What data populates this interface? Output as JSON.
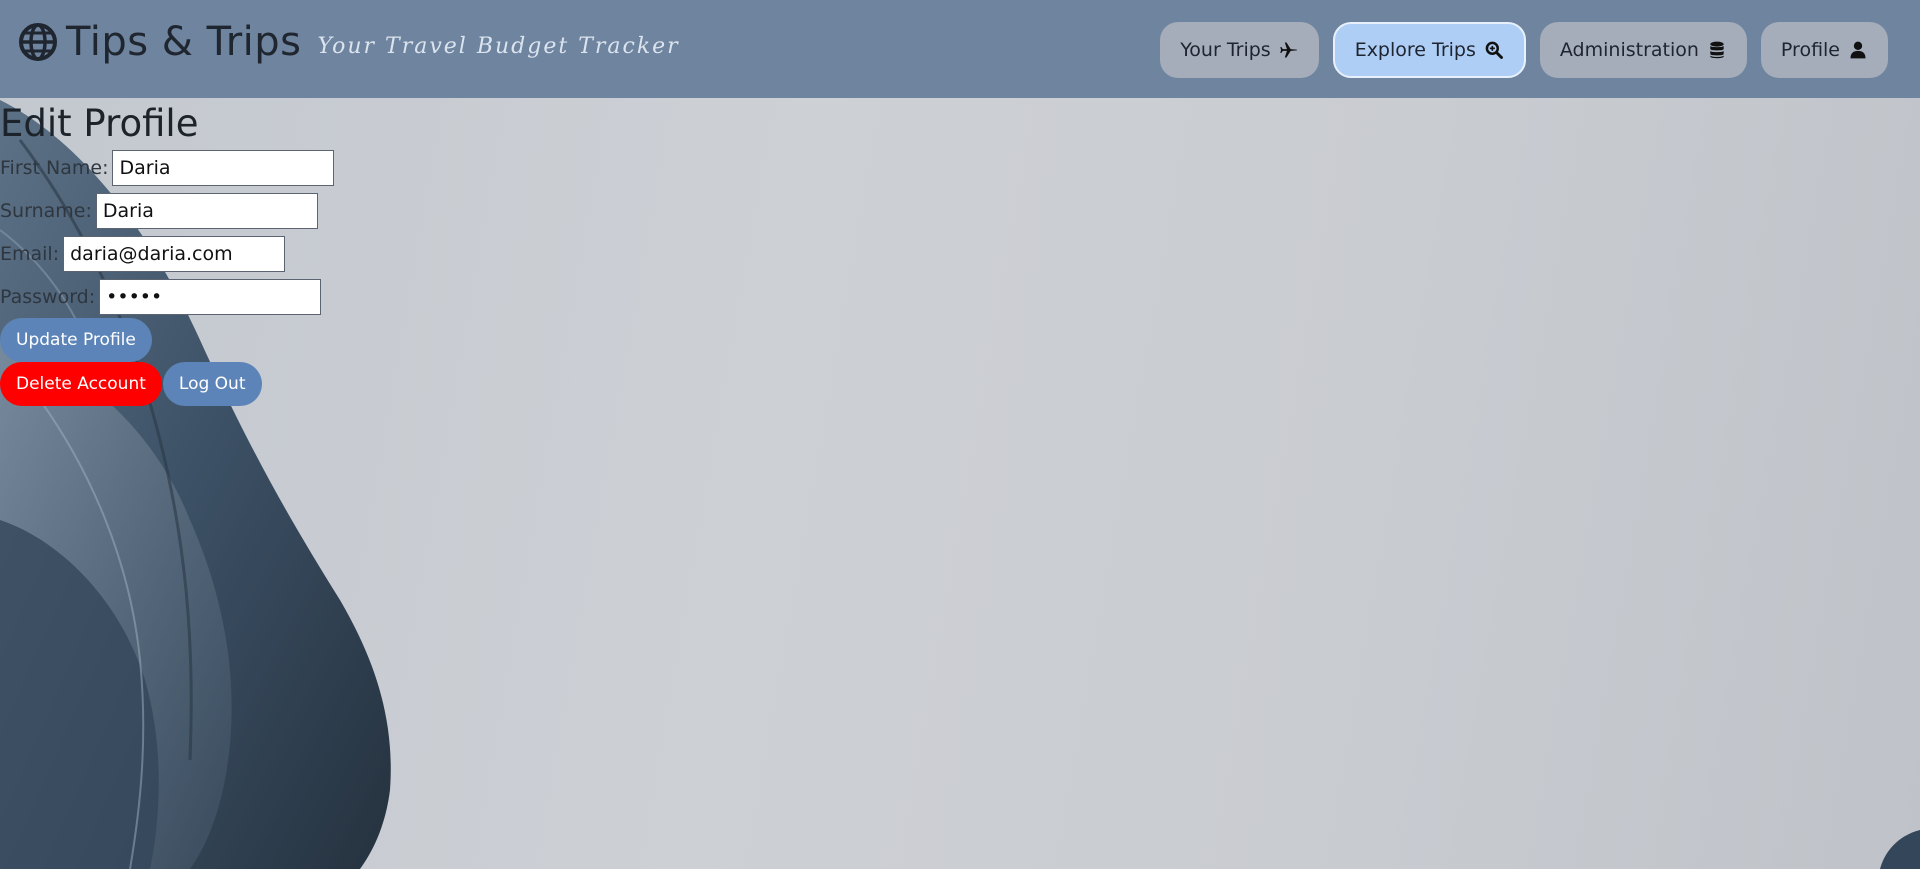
{
  "header": {
    "brand_title": "Tips & Trips",
    "tagline": "Your Travel Budget Tracker",
    "logo_icon": "globe-icon"
  },
  "nav": [
    {
      "label": "Your Trips",
      "icon": "plane-icon",
      "active": false
    },
    {
      "label": "Explore Trips",
      "icon": "search-icon",
      "active": true
    },
    {
      "label": "Administration",
      "icon": "database-icon",
      "active": false
    },
    {
      "label": "Profile",
      "icon": "user-icon",
      "active": false
    }
  ],
  "form": {
    "title": "Edit Profile",
    "first_name_label": "First Name:",
    "first_name_value": "Daria",
    "surname_label": "Surname:",
    "surname_value": "Daria",
    "email_label": "Email:",
    "email_value": "daria@daria.com",
    "password_label": "Password:",
    "password_value": "•••••"
  },
  "actions": {
    "update": "Update Profile",
    "delete": "Delete Account",
    "logout": "Log Out"
  },
  "colors": {
    "header_bg": "#6e849f",
    "nav_active_bg": "#aecef6",
    "primary_button": "#5c84b8",
    "danger_button": "#ff0000"
  }
}
